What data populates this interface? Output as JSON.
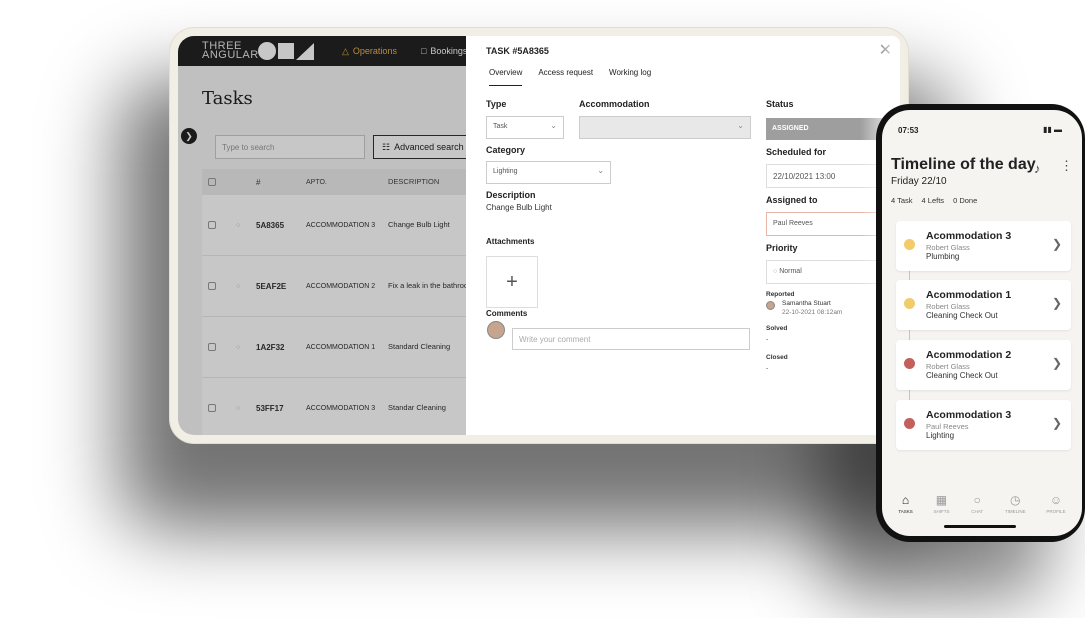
{
  "app": {
    "logo_text": "THREE ANGULAR",
    "nav": [
      {
        "label": "Operations",
        "icon": "warning-icon",
        "color": "#f0b34a"
      },
      {
        "label": "Bookings",
        "icon": "square-icon"
      }
    ],
    "page_title": "Tasks",
    "search_placeholder": "Type to search",
    "advanced_search_label": "Advanced search",
    "table": {
      "headers": [
        "#",
        "APTO.",
        "DESCRIPTION"
      ],
      "rows": [
        {
          "id": "5A8365",
          "apto": "ACCOMMODATION 3",
          "desc": "Change Bulb Light"
        },
        {
          "id": "5EAF2E",
          "apto": "ACCOMMODATION 2",
          "desc": "Fix a leak in the bathroom"
        },
        {
          "id": "1A2F32",
          "apto": "ACCOMMODATION 1",
          "desc": "Standard Cleaning"
        },
        {
          "id": "53FF17",
          "apto": "ACCOMMODATION 3",
          "desc": "Standar Cleaning"
        }
      ]
    }
  },
  "panel": {
    "task_id": "TASK #5A8365",
    "tabs": [
      "Overview",
      "Access request",
      "Working log"
    ],
    "type_label": "Type",
    "type_value": "Task",
    "accommodation_label": "Accommodation",
    "accommodation_value": "",
    "category_label": "Category",
    "category_value": "Lighting",
    "description_label": "Description",
    "description_value": "Change Bulb Light",
    "attachments_label": "Attachments",
    "comments_label": "Comments",
    "comment_placeholder": "Write your comment",
    "status_label": "Status",
    "status_value": "ASSIGNED",
    "scheduled_label": "Scheduled for",
    "scheduled_value": "22/10/2021 13:00",
    "assigned_label": "Assigned to",
    "assigned_value": "Paul Reeves",
    "priority_label": "Priority",
    "priority_value": "Normal",
    "reported_label": "Reported",
    "reporter_name": "Samantha Stuart",
    "reported_at": "22-10-2021 08:12am",
    "solved_label": "Solved",
    "solved_value": "-",
    "closed_label": "Closed",
    "closed_value": "-"
  },
  "phone": {
    "time": "07:53",
    "title": "Timeline of the day",
    "date": "Friday 22/10",
    "stats": [
      "4 Task",
      "4 Lefts",
      "0 Done"
    ],
    "cards": [
      {
        "title": "Acommodation 3",
        "person": "Robert Glass",
        "task": "Plumbing",
        "color": "#f2cb6a"
      },
      {
        "title": "Acommodation 1",
        "person": "Robert Glass",
        "task": "Cleaning Check Out",
        "color": "#f2cb6a"
      },
      {
        "title": "Acommodation 2",
        "person": "Robert Glass",
        "task": "Cleaning Check Out",
        "color": "#c4605c"
      },
      {
        "title": "Acommodation 3",
        "person": "Paul Reeves",
        "task": "Lighting",
        "color": "#c4605c"
      }
    ],
    "tabbar": [
      "TASKS",
      "SHIFTS",
      "CHAT",
      "TIMELINE",
      "PROFILE"
    ]
  }
}
